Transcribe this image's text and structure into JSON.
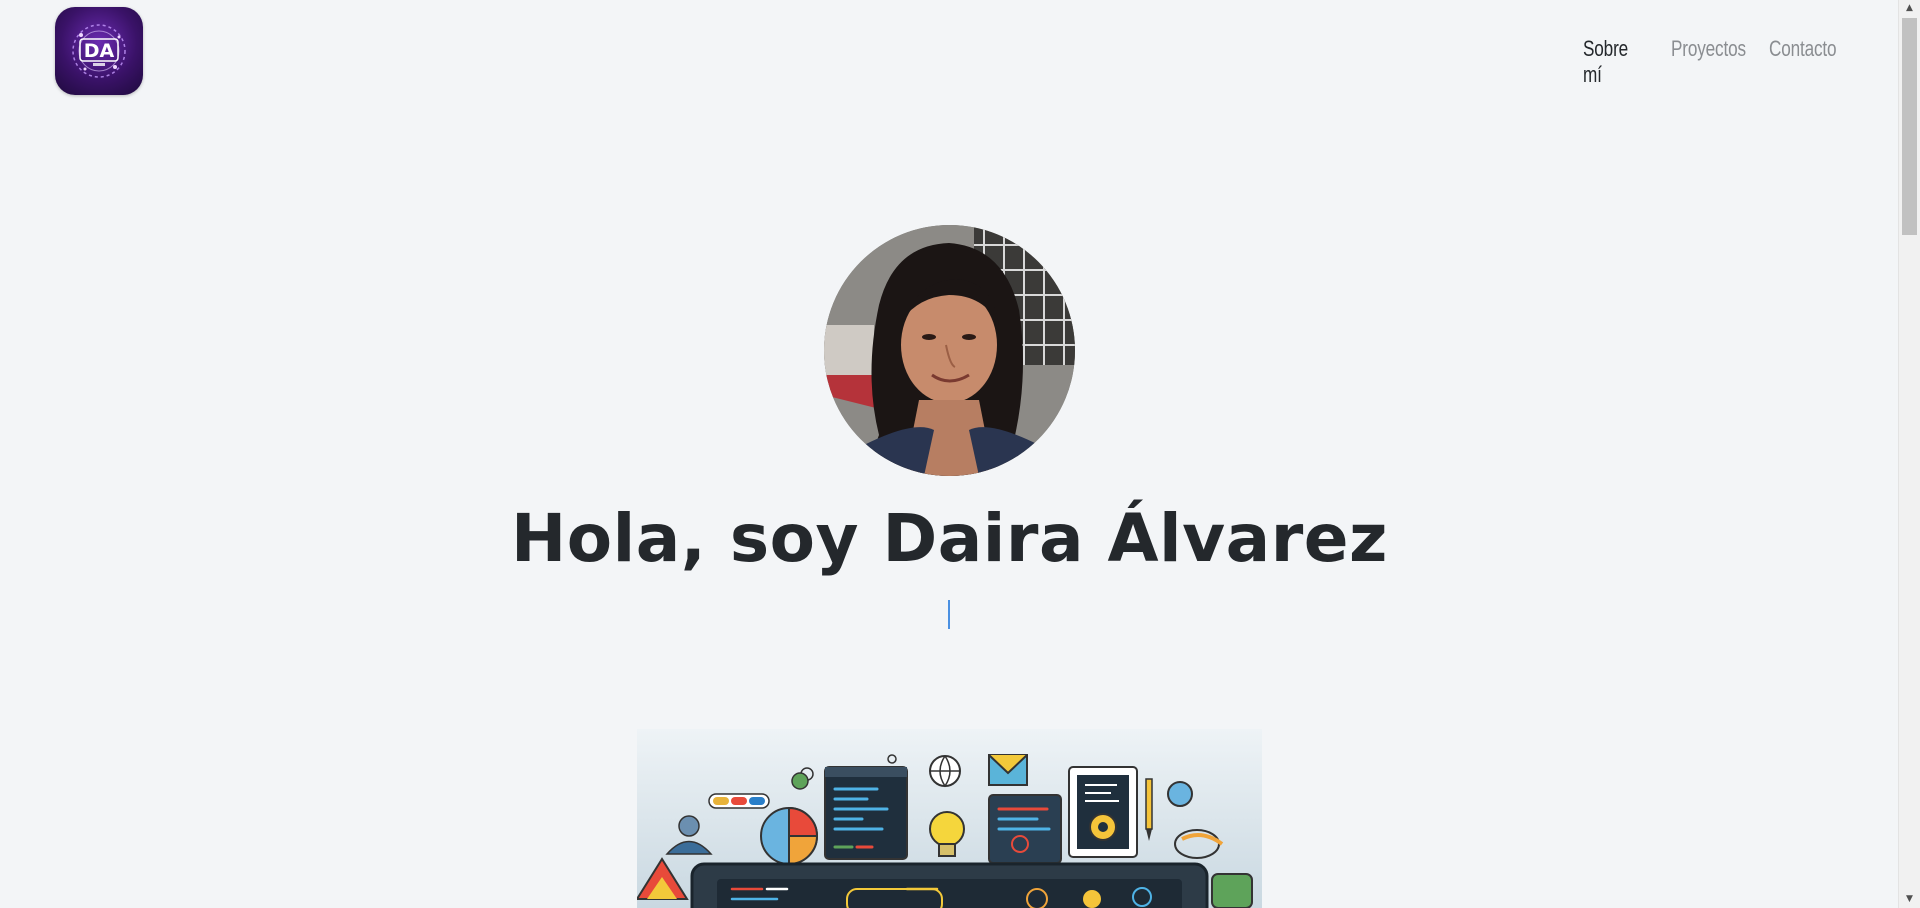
{
  "header": {
    "logo_text": "DA",
    "nav": [
      {
        "label": "Sobre mí",
        "active": true
      },
      {
        "label": "Proyectos",
        "active": false
      },
      {
        "label": "Contacto",
        "active": false
      }
    ]
  },
  "hero": {
    "title": "Hola, soy Daira Álvarez"
  },
  "colors": {
    "background": "#f3f5f7",
    "text": "#24282c",
    "nav_inactive": "#8a8d91",
    "cursor": "#4a90e2",
    "logo": "#3a1268"
  },
  "icons": {
    "scroll_up": "scroll-up-arrow-icon",
    "scroll_down": "scroll-down-arrow-icon"
  }
}
